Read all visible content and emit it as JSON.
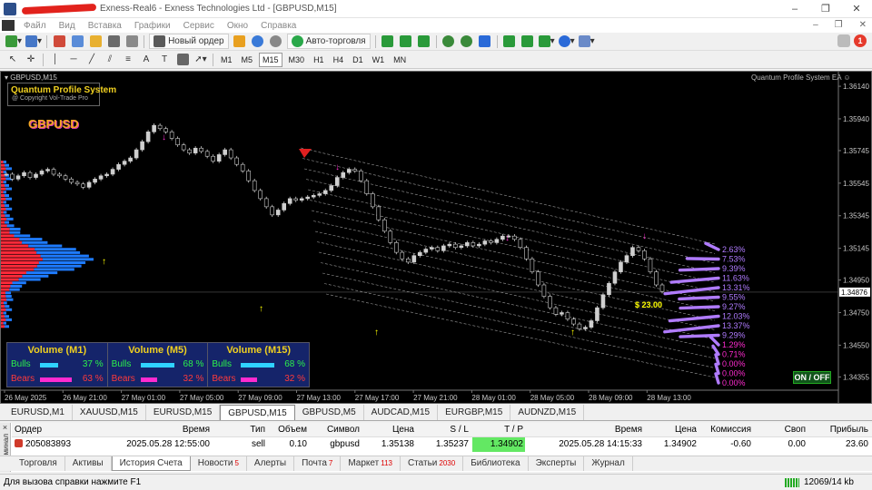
{
  "window": {
    "title": "Exness-Real6 - Exness Technologies Ltd - [GBPUSD,M15]"
  },
  "menu": [
    "Файл",
    "Вид",
    "Вставка",
    "Графики",
    "Сервис",
    "Окно",
    "Справка"
  ],
  "toolbar": {
    "new_order": "Новый ордер",
    "auto_trading": "Авто-торговля",
    "timeframes": [
      "M1",
      "M5",
      "M15",
      "M30",
      "H1",
      "H4",
      "D1",
      "W1",
      "MN"
    ],
    "active_timeframe": "M15",
    "notification_count": "1"
  },
  "chart": {
    "tab_label": "GBPUSD,M15",
    "ea_name": "Quantum Profile System EA",
    "qps_title": "Quantum Profile System",
    "qps_copyright": "@ Copyright Vol-Trade Pro",
    "symbol": "GBPUSD",
    "profit_label": "$ 23.00",
    "onoff_label": "ON / OFF",
    "colors": {
      "bull_candle": "#cfcfcf",
      "channel_line": "#9a9a9a",
      "up_arrow": "#ffff00",
      "down_arrow": "#ff2bd0",
      "volume_profile_blue": "#1e7bff",
      "volume_profile_red": "#ff2a3a",
      "pct_label": "#b07bff"
    }
  },
  "chart_data": {
    "type": "candlestick",
    "symbol": "GBPUSD",
    "timeframe": "M15",
    "ylim": [
      1.34307,
      1.36185
    ],
    "yticks": [
      "1.36140",
      "1.35940",
      "1.35745",
      "1.35545",
      "1.35345",
      "1.35145",
      "1.34950",
      "1.34750",
      "1.34550",
      "1.34355"
    ],
    "current_price": "1.34876",
    "xticks": [
      "26 May 2025",
      "26 May 21:00",
      "27 May 01:00",
      "27 May 05:00",
      "27 May 09:00",
      "27 May 13:00",
      "27 May 17:00",
      "27 May 21:00",
      "28 May 01:00",
      "28 May 05:00",
      "28 May 09:00",
      "28 May 13:00"
    ],
    "channel_percentages": [
      "2.63%",
      "7.53%",
      "9.39%",
      "11.63%",
      "13.31%",
      "9.55%",
      "9.27%",
      "12.03%",
      "13.37%",
      "9.29%",
      "1.29%",
      "0.71%",
      "0.00%",
      "0.00%",
      "0.00%"
    ],
    "close": [
      1.356,
      1.3557,
      1.3559,
      1.3561,
      1.3558,
      1.356,
      1.3562,
      1.3563,
      1.356,
      1.3559,
      1.3557,
      1.3555,
      1.3554,
      1.3552,
      1.3555,
      1.3557,
      1.3559,
      1.356,
      1.3563,
      1.3566,
      1.3568,
      1.357,
      1.3575,
      1.358,
      1.3586,
      1.359,
      1.3588,
      1.3586,
      1.3582,
      1.3578,
      1.3575,
      1.3573,
      1.3576,
      1.3574,
      1.3571,
      1.3568,
      1.3572,
      1.3575,
      1.357,
      1.3566,
      1.3562,
      1.3556,
      1.355,
      1.3545,
      1.354,
      1.3535,
      1.3538,
      1.3542,
      1.3545,
      1.3544,
      1.3545,
      1.3546,
      1.3547,
      1.3548,
      1.355,
      1.3553,
      1.3558,
      1.3561,
      1.3563,
      1.3562,
      1.3556,
      1.3548,
      1.354,
      1.3532,
      1.3525,
      1.3518,
      1.3512,
      1.3508,
      1.3506,
      1.351,
      1.3512,
      1.3514,
      1.3515,
      1.3513,
      1.3516,
      1.3517,
      1.3515,
      1.3516,
      1.3518,
      1.3516,
      1.3517,
      1.3519,
      1.3518,
      1.352,
      1.3522,
      1.3522,
      1.352,
      1.3515,
      1.3508,
      1.35,
      1.3492,
      1.3485,
      1.3478,
      1.3474,
      1.3475,
      1.3471,
      1.3468,
      1.3465,
      1.3466,
      1.347,
      1.3478,
      1.3486,
      1.3493,
      1.35,
      1.3506,
      1.351,
      1.3515,
      1.3513,
      1.3508,
      1.35,
      1.3492,
      1.3488
    ]
  },
  "volume": [
    {
      "title": "Volume (M1)",
      "bulls_label": "Bulls",
      "bears_label": "Bears",
      "bulls_pct": "37 %",
      "bears_pct": "63 %",
      "bulls": 37,
      "bears": 63
    },
    {
      "title": "Volume (M5)",
      "bulls_label": "Bulls",
      "bears_label": "Bears",
      "bulls_pct": "68 %",
      "bears_pct": "32 %",
      "bulls": 68,
      "bears": 32
    },
    {
      "title": "Volume (M15)",
      "bulls_label": "Bulls",
      "bears_label": "Bears",
      "bulls_pct": "68 %",
      "bears_pct": "32 %",
      "bulls": 68,
      "bears": 32
    }
  ],
  "symbol_tabs": [
    "EURUSD,M1",
    "XAUUSD,M15",
    "EURUSD,M15",
    "GBPUSD,M15",
    "GBPUSD,M5",
    "AUDCAD,M15",
    "EURGBP,M15",
    "AUDNZD,M15"
  ],
  "active_symbol_tab": "GBPUSD,M15",
  "terminal": {
    "side_label": "Терминал",
    "headers": {
      "order": "Ордер",
      "open_time": "Время",
      "type": "Тип",
      "volume": "Объем",
      "symbol": "Символ",
      "price": "Цена",
      "sl": "S / L",
      "tp": "T / P",
      "close_time": "Время",
      "close_price": "Цена",
      "commission": "Комиссия",
      "swap": "Своп",
      "profit": "Прибыль"
    },
    "rows": [
      {
        "order": "205083893",
        "open_time": "2025.05.28 12:55:00",
        "type": "sell",
        "volume": "0.10",
        "symbol": "gbpusd",
        "price": "1.35138",
        "sl": "1.35237",
        "tp": "1.34902",
        "close_time": "2025.05.28 14:15:33",
        "close_price": "1.34902",
        "commission": "-0.60",
        "swap": "0.00",
        "profit": "23.60"
      }
    ]
  },
  "bottom_tabs": [
    {
      "label": "Торговля",
      "badge": ""
    },
    {
      "label": "Активы",
      "badge": ""
    },
    {
      "label": "История Счета",
      "badge": ""
    },
    {
      "label": "Новости",
      "badge": "5"
    },
    {
      "label": "Алерты",
      "badge": ""
    },
    {
      "label": "Почта",
      "badge": "7"
    },
    {
      "label": "Маркет",
      "badge": "113"
    },
    {
      "label": "Статьи",
      "badge": "2030"
    },
    {
      "label": "Библиотека",
      "badge": ""
    },
    {
      "label": "Эксперты",
      "badge": ""
    },
    {
      "label": "Журнал",
      "badge": ""
    }
  ],
  "active_bottom_tab": "История Счета",
  "status": {
    "help": "Для вызова справки нажмите F1",
    "traffic": "12069/14 kb"
  }
}
